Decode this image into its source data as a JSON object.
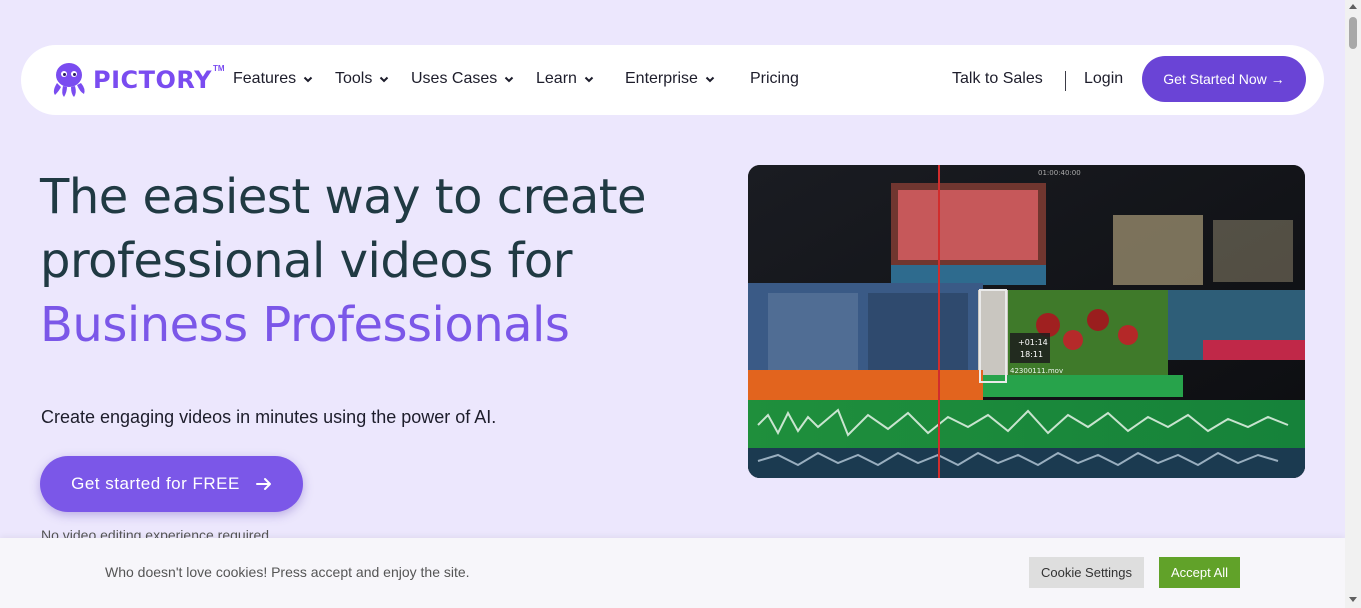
{
  "brand": {
    "name": "PICTORY",
    "tm": "TM",
    "color": "#7a4cf0"
  },
  "nav": {
    "items": [
      {
        "label": "Features",
        "has_dropdown": true
      },
      {
        "label": "Tools",
        "has_dropdown": true
      },
      {
        "label": "Uses Cases",
        "has_dropdown": true
      },
      {
        "label": "Learn",
        "has_dropdown": true
      },
      {
        "label": "Enterprise",
        "has_dropdown": true
      },
      {
        "label": "Pricing",
        "has_dropdown": false
      }
    ],
    "talk_to_sales": "Talk to Sales",
    "login": "Login",
    "cta": "Get Started Now →"
  },
  "hero": {
    "line1": "The easiest way to create",
    "line2": "professional videos for",
    "line3": "Business Professionals",
    "subtitle": "Create engaging videos in minutes using the power of AI.",
    "cta": "Get started for FREE",
    "cta_icon": "arrow-right-icon",
    "note": "No video editing experience required"
  },
  "video": {
    "timecode_top": "01:00:40:00",
    "overlay_time_1": "+01:14",
    "overlay_time_2": "18:11",
    "clip_name": "42300111.mov"
  },
  "cookie": {
    "text": "Who doesn't love cookies! Press accept and enjoy the site.",
    "settings": "Cookie Settings",
    "accept": "Accept All"
  },
  "colors": {
    "background": "#ece7fd",
    "primary": "#6a44d6",
    "accent": "#7b57e8",
    "heading": "#203a43",
    "accept": "#61a229"
  }
}
